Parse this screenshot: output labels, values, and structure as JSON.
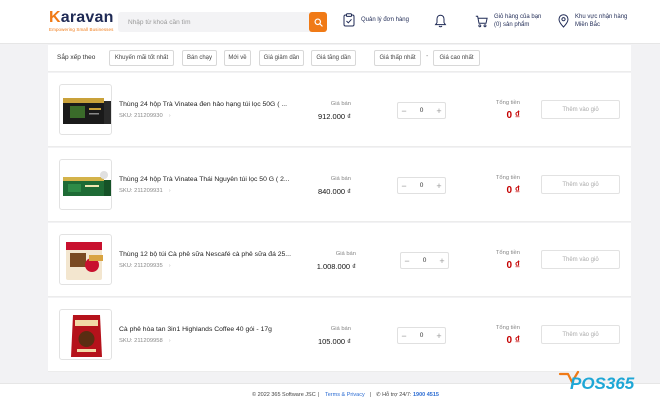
{
  "header": {
    "logo_text": "Karavan",
    "tagline": "Empowering Small Businesses",
    "search_placeholder": "Nhập từ khoá cần tìm",
    "orders_label": "Quản lý đơn hàng",
    "cart_line1": "Giỏ hàng của bạn",
    "cart_line2": "(0) sản phẩm",
    "region_line1": "Khu vực nhận hàng",
    "region_line2": "Miền Bắc",
    "brand_color": "#f07a16"
  },
  "sort": {
    "label": "Sắp xếp theo",
    "options": [
      "Khuyến mãi tốt nhất",
      "Bán chạy",
      "Mới về",
      "Giá giảm dần",
      "Giá tăng dần"
    ],
    "price_min_placeholder": "Giá thấp nhất",
    "price_max_placeholder": "Giá cao nhất",
    "range_separator": "-"
  },
  "products": [
    {
      "name": "Thùng 24 hộp Trà Vinatea đen hảo hạng túi lọc 50G ( ...",
      "sku": "SKU: 211209930",
      "price_label": "Giá bán",
      "price": "912.000 ₫",
      "qty": "0",
      "total_label": "Tổng tiền",
      "total": "0 ₫",
      "cart_label": "Thêm vào giỏ",
      "image": "black-tea-box-icon"
    },
    {
      "name": "Thùng 24 hộp Trà Vinatea Thái Nguyên túi lọc 50 G ( 2...",
      "sku": "SKU: 211209931",
      "price_label": "Giá bán",
      "price": "840.000 ₫",
      "qty": "0",
      "total_label": "Tổng tiền",
      "total": "0 ₫",
      "cart_label": "Thêm vào giỏ",
      "image": "green-tea-box-icon"
    },
    {
      "name": "Thùng 12 bộ túi Cà phê sữa Nescafé cà phê sữa đá 25...",
      "sku": "SKU: 211209935",
      "price_label": "Giá bán",
      "price": "1.008.000 ₫",
      "qty": "0",
      "total_label": "Tổng tiền",
      "total": "0 ₫",
      "cart_label": "Thêm vào giỏ",
      "image": "nescafe-bag-icon"
    },
    {
      "name": "Cà phê hòa tan 3in1 Highlands Coffee 40 gói - 17g",
      "sku": "SKU: 211209958",
      "price_label": "Giá bán",
      "price": "105.000 ₫",
      "qty": "0",
      "total_label": "Tổng tiền",
      "total": "0 ₫",
      "cart_label": "Thêm vào giỏ",
      "image": "highlands-coffee-bag-icon"
    }
  ],
  "footer": {
    "copyright": "© 2022 365 Software JSC",
    "sep": "|",
    "terms": "Terms & Privacy",
    "support_label": "Hỗ trợ 24/7:",
    "phone": "1900 4515"
  },
  "watermark": "POS365",
  "colors": {
    "price_total": "#c40000",
    "link": "#2b6cd3",
    "watermark": "#1ea7d6"
  }
}
